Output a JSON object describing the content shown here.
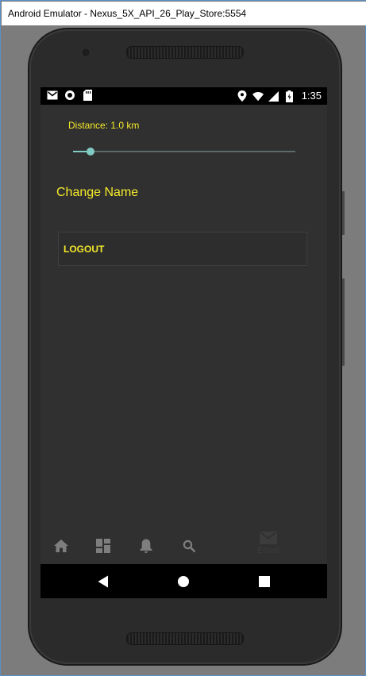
{
  "window": {
    "title": "Android Emulator - Nexus_5X_API_26_Play_Store:5554"
  },
  "statusbar": {
    "left_icons": [
      "gmail-icon",
      "record-icon",
      "sd-card-icon"
    ],
    "right_icons": [
      "location-icon",
      "wifi-icon",
      "signal-icon",
      "battery-icon"
    ],
    "time": "1:35"
  },
  "settings": {
    "distance_label": "Distance: 1.0 km",
    "distance_slider_fraction": 0.05,
    "change_name_label": "Change Name",
    "logout_label": "LOGOUT"
  },
  "bottom_nav": {
    "items": [
      "home-icon",
      "dashboard-icon",
      "notifications-icon",
      "search-icon"
    ],
    "email_label": "Email"
  },
  "android_nav": [
    "back-button",
    "home-button",
    "recents-button"
  ],
  "colors": {
    "accent_yellow": "#f5ea2a",
    "slider_teal": "#80cbc4",
    "background": "#303030"
  }
}
